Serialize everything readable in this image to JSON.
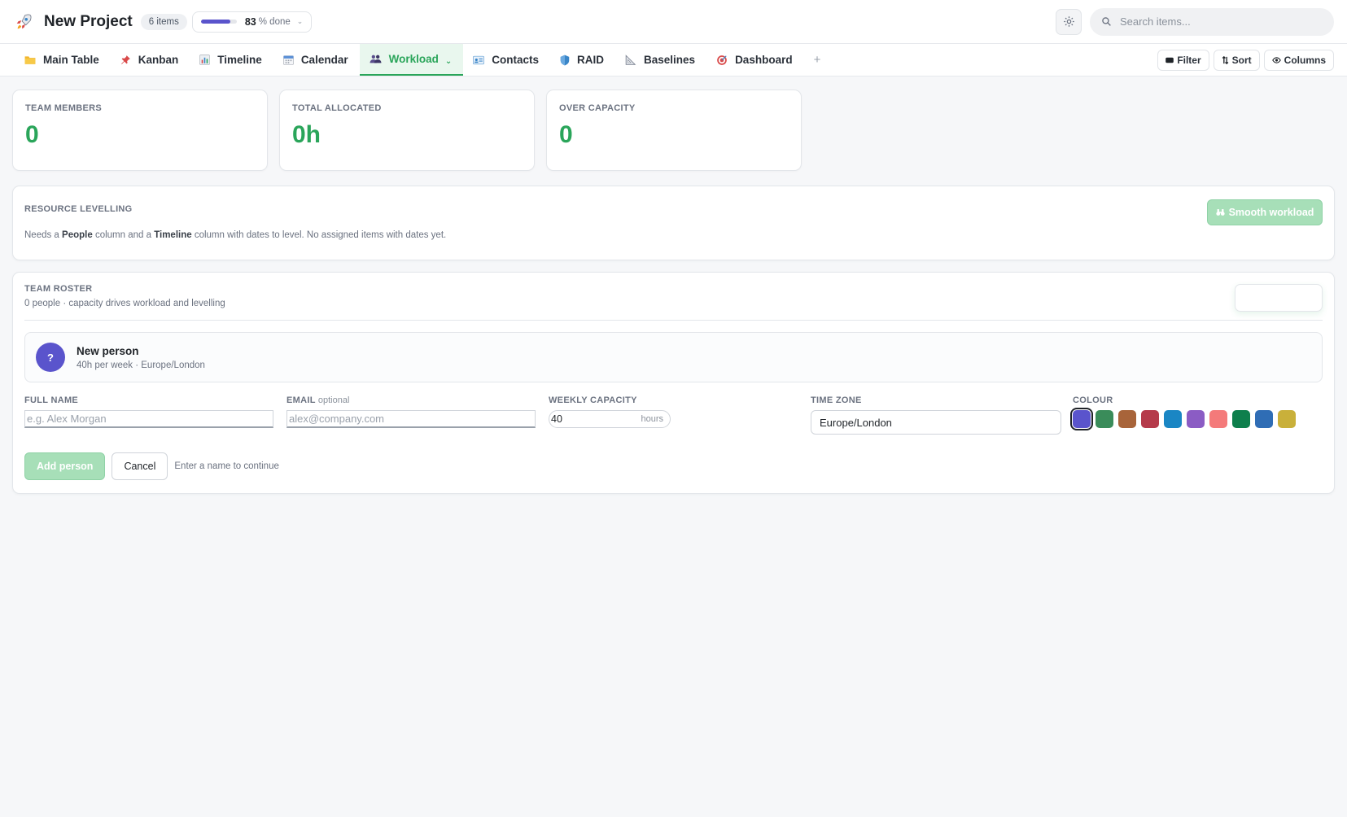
{
  "header": {
    "logo_icon": "rocket-icon",
    "project_title": "New Project",
    "item_count": "6 items",
    "progress_value": 83,
    "progress_fraction": 0.83,
    "progress_label": "% done",
    "progress_caret": "⌄",
    "settings_icon": "gear-icon",
    "search_placeholder": "Search items..."
  },
  "tabs": [
    {
      "label": "Main Table",
      "icon": "folder-icon",
      "active": false
    },
    {
      "label": "Kanban",
      "icon": "pushpin-icon",
      "active": false
    },
    {
      "label": "Timeline",
      "icon": "bar-chart-icon",
      "active": false
    },
    {
      "label": "Calendar",
      "icon": "calendar-icon",
      "active": false
    },
    {
      "label": "Workload",
      "icon": "people-icon",
      "active": true
    },
    {
      "label": "Contacts",
      "icon": "id-card-icon",
      "active": false
    },
    {
      "label": "RAID",
      "icon": "shield-icon",
      "active": false
    },
    {
      "label": "Baselines",
      "icon": "triangle-ruler-icon",
      "active": false
    },
    {
      "label": "Dashboard",
      "icon": "target-icon",
      "active": false
    }
  ],
  "tab_add": "+",
  "active_tab_chevron": "⌄",
  "toolbar": {
    "filter_label": "Filter",
    "sort_label": "Sort",
    "columns_label": "Columns"
  },
  "stats": [
    {
      "label": "TEAM MEMBERS",
      "value": "0"
    },
    {
      "label": "TOTAL ALLOCATED",
      "value": "0h"
    },
    {
      "label": "OVER CAPACITY",
      "value": "0"
    }
  ],
  "levelling": {
    "title": "RESOURCE LEVELLING",
    "desc_part1": "Needs a ",
    "desc_bold1": "People",
    "desc_part2": " column and a ",
    "desc_bold2": "Timeline",
    "desc_part3": " column with dates to level. No assigned items with dates yet.",
    "button_label": "Smooth workload"
  },
  "roster": {
    "title": "TEAM ROSTER",
    "subtitle": "0 people · capacity drives workload and levelling",
    "preview": {
      "avatar_initial": "?",
      "name": "New person",
      "meta": "40h per week · Europe/London"
    },
    "form": {
      "name_label": "FULL NAME",
      "name_placeholder": "e.g. Alex Morgan",
      "email_label": "EMAIL",
      "email_optional": "optional",
      "email_placeholder": "alex@company.com",
      "capacity_label": "WEEKLY CAPACITY",
      "capacity_value": "40",
      "capacity_unit": "hours",
      "timezone_label": "TIME ZONE",
      "timezone_value": "Europe/London",
      "colour_label": "COLOUR",
      "colours": [
        "#5a54cc",
        "#3a8c5a",
        "#a8643a",
        "#b53a4a",
        "#1a86c4",
        "#8b5cc4",
        "#f47a7a",
        "#0e7f4c",
        "#2f6db5",
        "#c9b03a"
      ],
      "selected_colour_index": 0
    },
    "add_label": "Add person",
    "cancel_label": "Cancel",
    "hint": "Enter a name to continue"
  }
}
